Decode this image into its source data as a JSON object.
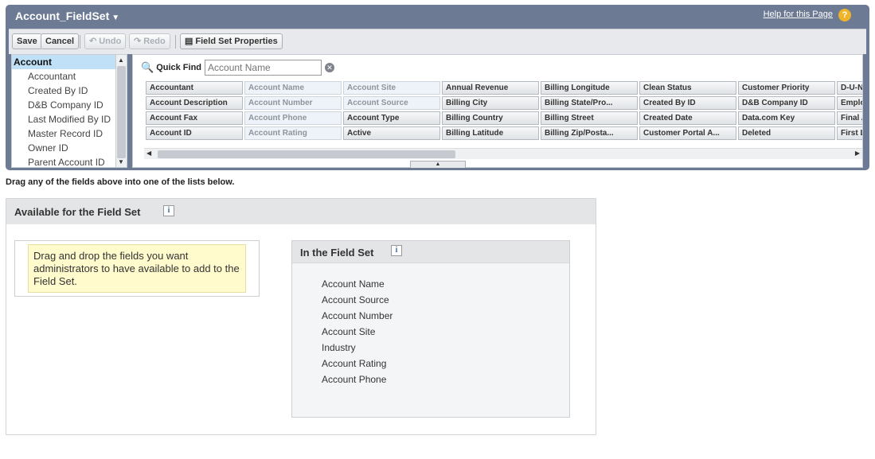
{
  "header": {
    "title": "Account_FieldSet",
    "help_link": "Help for this Page",
    "help_icon": "?"
  },
  "toolbar": {
    "save": "Save",
    "cancel": "Cancel",
    "undo": "Undo",
    "redo": "Redo",
    "properties": "Field Set Properties"
  },
  "objects": [
    "Account",
    "Accountant",
    "Created By ID",
    "D&B Company ID",
    "Last Modified By ID",
    "Master Record ID",
    "Owner ID",
    "Parent Account ID"
  ],
  "quick_find": {
    "label": "Quick Find",
    "placeholder": "Account Name"
  },
  "fields": [
    [
      "Accountant",
      "Account Name",
      "Account Site",
      "Annual Revenue",
      "Billing Longitude",
      "Clean Status",
      "Customer Priority",
      "D-U-N-"
    ],
    [
      "Account Description",
      "Account Number",
      "Account Source",
      "Billing City",
      "Billing State/Pro...",
      "Created By ID",
      "D&B Company ID",
      "Emplo"
    ],
    [
      "Account Fax",
      "Account Phone",
      "Account Type",
      "Billing Country",
      "Billing Street",
      "Created Date",
      "Data.com Key",
      "Final A"
    ],
    [
      "Account ID",
      "Account Rating",
      "Active",
      "Billing Latitude",
      "Billing Zip/Posta...",
      "Customer Portal A...",
      "Deleted",
      "First L"
    ]
  ],
  "used_fields": [
    "Account Name",
    "Account Site",
    "Account Number",
    "Account Source",
    "Account Phone",
    "Account Rating"
  ],
  "instructions": "Drag any of the fields above into one of the lists below.",
  "available": {
    "title": "Available for the Field Set",
    "info": "i",
    "hint": "Drag and drop the fields you want administrators to have available to add to the Field Set."
  },
  "in_field_set": {
    "title": "In the Field Set",
    "info": "i",
    "items": [
      "Account Name",
      "Account Source",
      "Account Number",
      "Account Site",
      "Industry",
      "Account Rating",
      "Account Phone"
    ]
  }
}
